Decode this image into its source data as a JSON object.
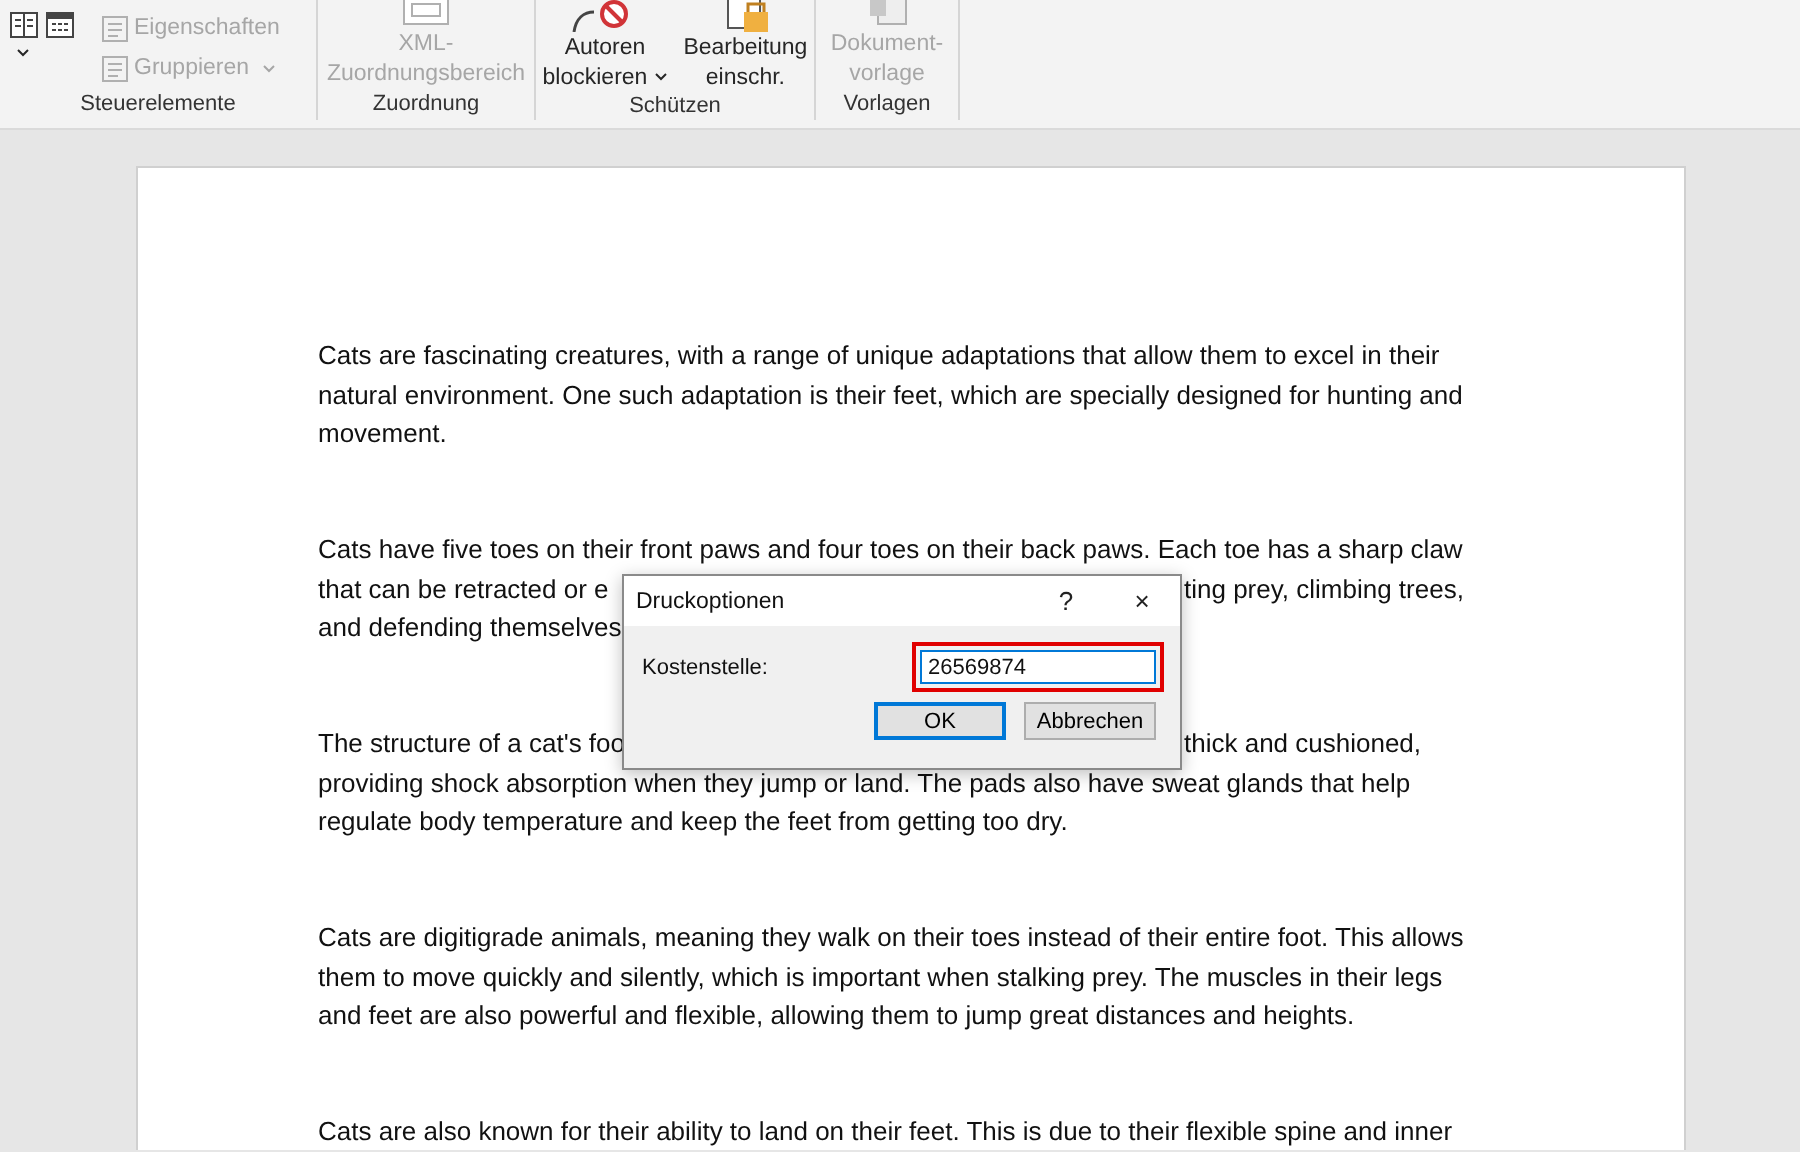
{
  "ribbon": {
    "groups": [
      {
        "label": "Steuerelemente",
        "items": [
          {
            "kind": "icons",
            "dropdown": true
          },
          {
            "kind": "small",
            "label": "Eigenschaften",
            "disabled": true,
            "dropdown": false
          },
          {
            "kind": "small",
            "label": "Gruppieren",
            "disabled": true,
            "dropdown": true
          }
        ]
      },
      {
        "label": "Zuordnung",
        "items": [
          {
            "kind": "large",
            "label": "XML-\nZuordnungsbereich",
            "disabled": true,
            "dropdown": false
          }
        ]
      },
      {
        "label": "Schützen",
        "items": [
          {
            "kind": "large",
            "label": "Autoren\nblockieren",
            "disabled": false,
            "dropdown": true
          },
          {
            "kind": "large",
            "label": "Bearbeitung\neinschr.",
            "disabled": false,
            "dropdown": false
          }
        ]
      },
      {
        "label": "Vorlagen",
        "items": [
          {
            "kind": "large",
            "label": "Dokument-\nvorlage",
            "disabled": true,
            "dropdown": false
          }
        ]
      }
    ]
  },
  "document": {
    "paragraphs": [
      {
        "lines": [
          {
            "left": "Cats are fascinating creatures, with a range of unique adaptations that allow them to excel in their"
          },
          {
            "left": "natural environment. One such adaptation is their feet, which are specially designed for hunting and"
          },
          {
            "left": "movement."
          }
        ]
      },
      {
        "lines": [
          {
            "left": "Cats have five toes on their front paws and four toes on their back paws. Each toe has a sharp claw"
          },
          {
            "left": "that can be retracted or e",
            "right": "ting prey, climbing trees,"
          },
          {
            "left": "and defending themselves"
          }
        ]
      },
      {
        "lines": [
          {
            "left": "The structure of a cat's foo",
            "right": "thick and cushioned,"
          },
          {
            "left": "providing shock absorption when they jump or land. The pads also have sweat glands that help"
          },
          {
            "left": "regulate body temperature and keep the feet from getting too dry."
          }
        ]
      },
      {
        "lines": [
          {
            "left": "Cats are digitigrade animals, meaning they walk on their toes instead of their entire foot. This allows"
          },
          {
            "left": "them to move quickly and silently, which is important when stalking prey. The muscles in their legs"
          },
          {
            "left": "and feet are also powerful and flexible, allowing them to jump great distances and heights."
          }
        ]
      },
      {
        "lines": [
          {
            "left": "Cats are also known for their ability to land on their feet. This is due to their flexible spine and inner"
          }
        ]
      }
    ]
  },
  "dialog": {
    "title": "Druckoptionen",
    "help": "?",
    "close": "×",
    "field_label": "Kostenstelle:",
    "field_value": "26569874",
    "field_highlighted": true,
    "buttons": [
      {
        "label": "OK",
        "default": true
      },
      {
        "label": "Abbrechen",
        "default": false
      }
    ]
  }
}
